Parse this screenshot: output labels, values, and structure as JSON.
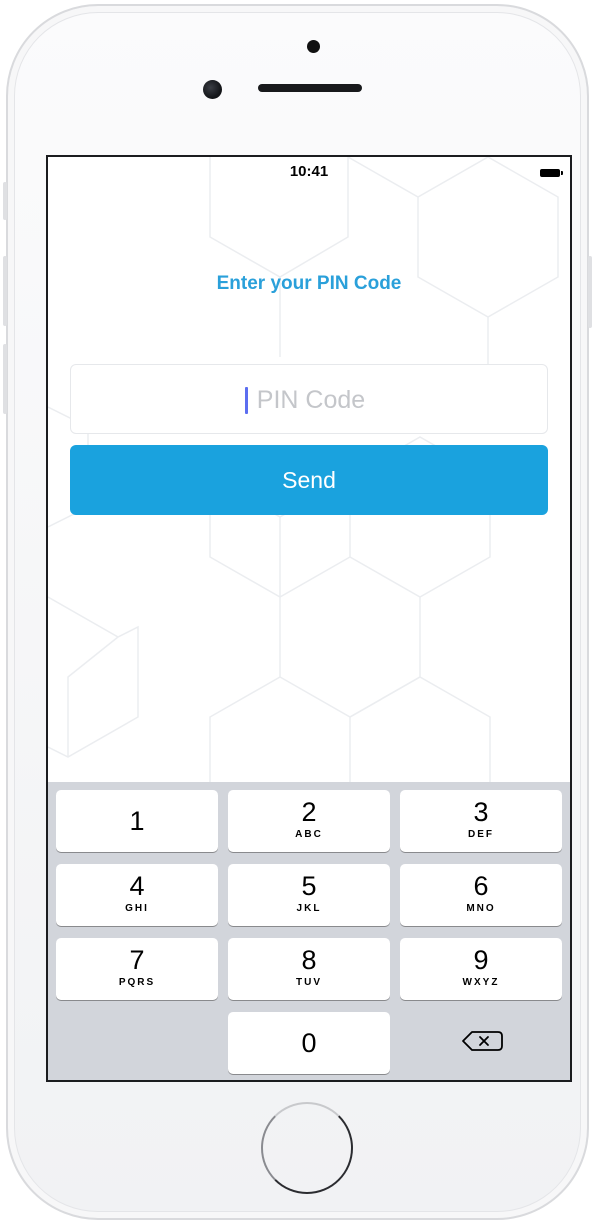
{
  "status_bar": {
    "time": "10:41"
  },
  "screen": {
    "title": "Enter your PIN Code",
    "pin_input": {
      "value": "",
      "placeholder": "PIN Code"
    },
    "send_label": "Send"
  },
  "keypad": {
    "keys": [
      {
        "digit": "1",
        "letters": ""
      },
      {
        "digit": "2",
        "letters": "ABC"
      },
      {
        "digit": "3",
        "letters": "DEF"
      },
      {
        "digit": "4",
        "letters": "GHI"
      },
      {
        "digit": "5",
        "letters": "JKL"
      },
      {
        "digit": "6",
        "letters": "MNO"
      },
      {
        "digit": "7",
        "letters": "PQRS"
      },
      {
        "digit": "8",
        "letters": "TUV"
      },
      {
        "digit": "9",
        "letters": "WXYZ"
      },
      {
        "digit": "0",
        "letters": ""
      }
    ],
    "backspace_icon": "backspace-icon"
  },
  "colors": {
    "accent": "#1aa2de",
    "title": "#2aa0da",
    "keyboard_bg": "#d2d5db"
  }
}
